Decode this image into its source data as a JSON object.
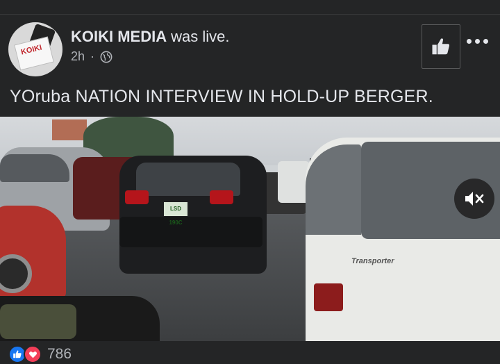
{
  "post": {
    "author": "KOIKI MEDIA",
    "action": "was live.",
    "time": "2h",
    "separator": "·",
    "privacy_icon": "globe-icon",
    "caption": "YOruba NATION INTERVIEW IN HOLD-UP BERGER.",
    "avatar_text": "KOIKI"
  },
  "header_actions": {
    "like_icon": "thumbs-up-icon",
    "more_icon": "more-horizontal-icon"
  },
  "video": {
    "plate_text": "LSD 190C",
    "van_model": "Transporter",
    "mute_icon": "speaker-muted-icon"
  },
  "reactions": {
    "icons": [
      "like-reaction-icon",
      "love-reaction-icon"
    ],
    "count": "786"
  },
  "colors": {
    "background": "#242526",
    "text_primary": "#e4e6eb",
    "text_secondary": "#b0b3b8",
    "like_blue": "#1877f2",
    "love_red": "#f33e58"
  }
}
